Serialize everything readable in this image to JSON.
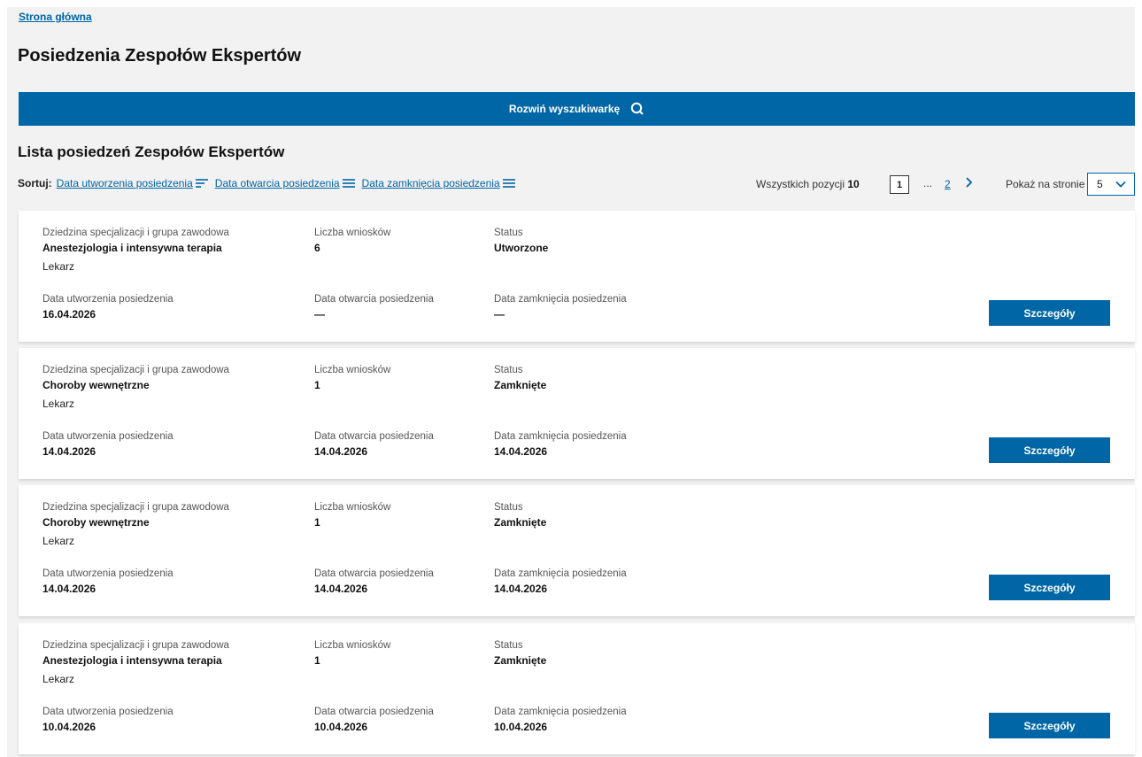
{
  "breadcrumb": "Strona główna",
  "page_title": "Posiedzenia Zespołów Ekspertów",
  "search_toggle": "Rozwiń wyszukiwarkę",
  "list_title": "Lista posiedzeń Zespołów Ekspertów",
  "sort": {
    "label": "Sortuj:",
    "options": [
      "Data utworzenia posiedzenia",
      "Data otwarcia posiedzenia",
      "Data zamknięcia posiedzenia"
    ]
  },
  "pagination": {
    "total_label": "Wszystkich pozycji",
    "total_value": "10",
    "current_page": "1",
    "ellipsis": "...",
    "last_page": "2",
    "per_page_label": "Pokaż na stronie",
    "per_page_value": "5"
  },
  "labels": {
    "specialization": "Dziedzina specjalizacji i grupa zawodowa",
    "applications": "Liczba wniosków",
    "status": "Status",
    "created": "Data utworzenia posiedzenia",
    "opened": "Data otwarcia posiedzenia",
    "closed": "Data zamknięcia posiedzenia",
    "details_button": "Szczegóły"
  },
  "meetings": [
    {
      "specialization": "Anestezjologia i intensywna terapia",
      "group": "Lekarz",
      "applications": "6",
      "status": "Utworzone",
      "created": "16.04.2026",
      "opened": "—",
      "closed": "—"
    },
    {
      "specialization": "Choroby wewnętrzne",
      "group": "Lekarz",
      "applications": "1",
      "status": "Zamknięte",
      "created": "14.04.2026",
      "opened": "14.04.2026",
      "closed": "14.04.2026"
    },
    {
      "specialization": "Choroby wewnętrzne",
      "group": "Lekarz",
      "applications": "1",
      "status": "Zamknięte",
      "created": "14.04.2026",
      "opened": "14.04.2026",
      "closed": "14.04.2026"
    },
    {
      "specialization": "Anestezjologia i intensywna terapia",
      "group": "Lekarz",
      "applications": "1",
      "status": "Zamknięte",
      "created": "10.04.2026",
      "opened": "10.04.2026",
      "closed": "10.04.2026"
    }
  ],
  "colors": {
    "primary": "#0066a6",
    "link": "#0064a6",
    "background": "#f2f2f2"
  }
}
